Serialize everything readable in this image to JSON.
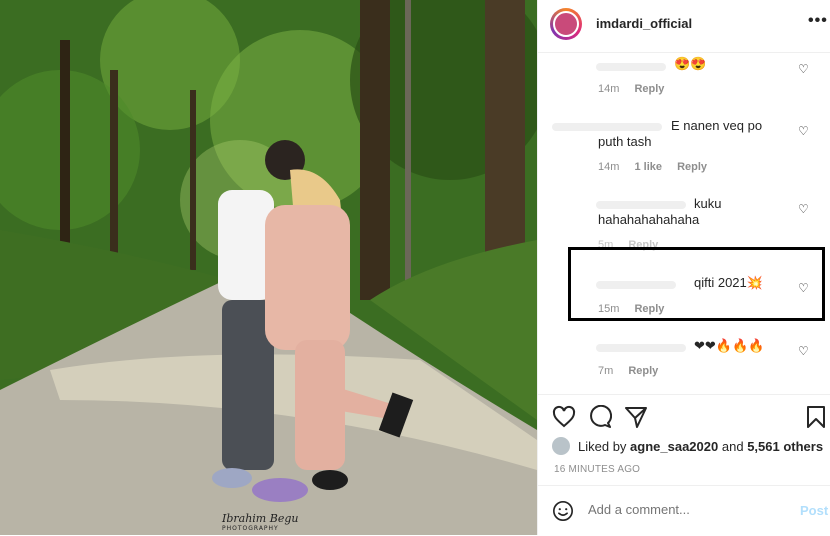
{
  "photo": {
    "watermark": "Ibrahim Begu",
    "watermark_sub": "PHOTOGRAPHY"
  },
  "header": {
    "username": "imdardi_official",
    "more_label": "•••"
  },
  "comments": [
    {
      "text": "😍😍",
      "time": "14m",
      "reply": "Reply",
      "likes": ""
    },
    {
      "text_line1": "E nanen veq po",
      "text_line2": "puth tash",
      "time": "14m",
      "likes": "1 like",
      "reply": "Reply"
    },
    {
      "text_line1": "kuku",
      "text_line2": "hahahahahahaha",
      "time": "5m",
      "reply": "Reply"
    },
    {
      "text": "qifti 2021💥",
      "time": "15m",
      "reply": "Reply"
    },
    {
      "text": "❤❤🔥🔥🔥",
      "time": "7m",
      "reply": "Reply"
    }
  ],
  "actions": {
    "liked_prefix": "Liked by",
    "liked_user": "agne_saa2020",
    "liked_and": "and",
    "liked_others": "5,561 others",
    "time_ago": "16 MINUTES AGO"
  },
  "add_comment": {
    "placeholder": "Add a comment...",
    "post_label": "Post"
  },
  "colors": {
    "link_disabled": "#b2dffc",
    "meta": "#8e8e8e",
    "text": "#262626"
  }
}
